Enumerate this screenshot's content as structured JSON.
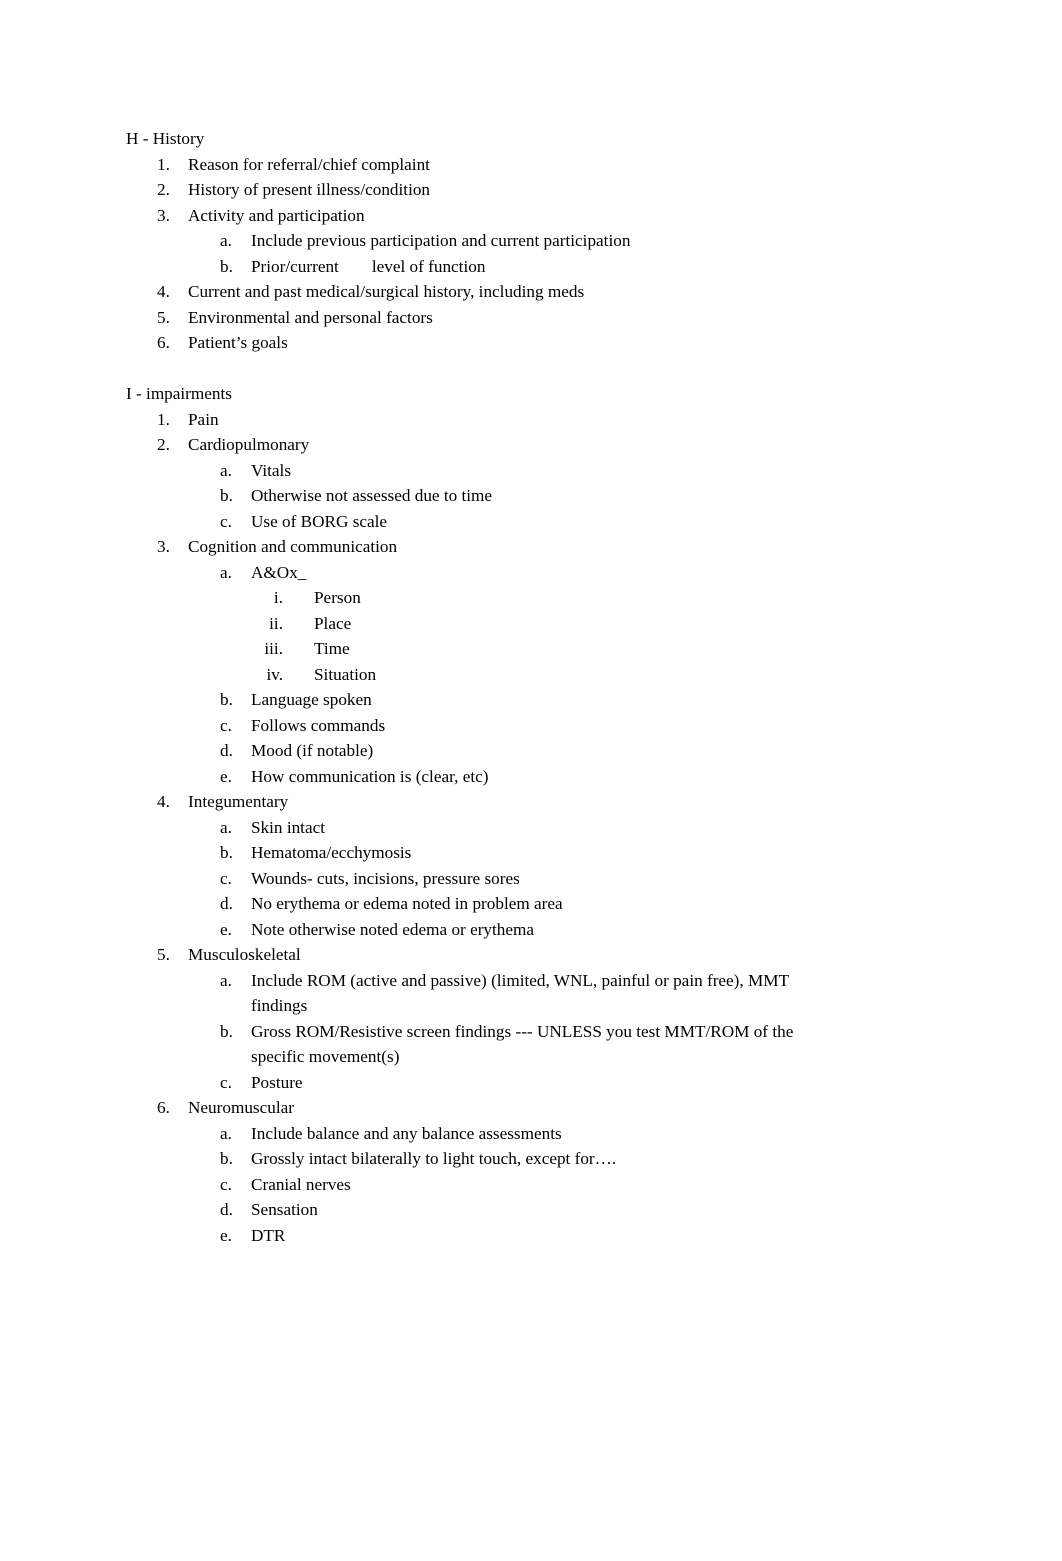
{
  "document": {
    "sections": [
      {
        "heading": "H - History",
        "items": [
          {
            "level": 1,
            "marker": "1.",
            "text": "Reason for referral/chief complaint"
          },
          {
            "level": 1,
            "marker": "2.",
            "text": "History of present illness/condition"
          },
          {
            "level": 1,
            "marker": "3.",
            "text": "Activity and participation"
          },
          {
            "level": 2,
            "marker": "a.",
            "text": "Include previous participation and current participation"
          },
          {
            "level": 2,
            "marker": "b.",
            "text": "Prior/current",
            "text_after_tab": "level of function"
          },
          {
            "level": 1,
            "marker": "4.",
            "text": "Current and past medical/surgical history, including meds"
          },
          {
            "level": 1,
            "marker": "5.",
            "text": "Environmental and personal factors"
          },
          {
            "level": 1,
            "marker": "6.",
            "text": "Patient’s goals"
          }
        ]
      },
      {
        "heading": "I - impairments",
        "items": [
          {
            "level": 1,
            "marker": "1.",
            "text": "Pain"
          },
          {
            "level": 1,
            "marker": "2.",
            "text": "Cardiopulmonary"
          },
          {
            "level": 2,
            "marker": "a.",
            "text": "Vitals"
          },
          {
            "level": 2,
            "marker": "b.",
            "text": "Otherwise not assessed due to time"
          },
          {
            "level": 2,
            "marker": "c.",
            "text": "Use of BORG scale"
          },
          {
            "level": 1,
            "marker": "3.",
            "text": "Cognition and communication"
          },
          {
            "level": 2,
            "marker": "a.",
            "text": "A&Ox_"
          },
          {
            "level": 3,
            "marker": "i.",
            "text": "Person"
          },
          {
            "level": 3,
            "marker": "ii.",
            "text": "Place"
          },
          {
            "level": 3,
            "marker": "iii.",
            "text": "Time"
          },
          {
            "level": 3,
            "marker": "iv.",
            "text": "Situation"
          },
          {
            "level": 2,
            "marker": "b.",
            "text": "Language spoken"
          },
          {
            "level": 2,
            "marker": "c.",
            "text": "Follows commands"
          },
          {
            "level": 2,
            "marker": "d.",
            "text": "Mood (if notable)"
          },
          {
            "level": 2,
            "marker": "e.",
            "text": "How communication is (clear, etc)"
          },
          {
            "level": 1,
            "marker": "4.",
            "text": "Integumentary"
          },
          {
            "level": 2,
            "marker": "a.",
            "text": "Skin intact"
          },
          {
            "level": 2,
            "marker": "b.",
            "text": "Hematoma/ecchymosis"
          },
          {
            "level": 2,
            "marker": "c.",
            "text": "Wounds- cuts, incisions, pressure sores"
          },
          {
            "level": 2,
            "marker": "d.",
            "text": "No erythema or edema noted in problem area"
          },
          {
            "level": 2,
            "marker": "e.",
            "text": "Note otherwise noted edema or erythema"
          },
          {
            "level": 1,
            "marker": "5.",
            "text": "Musculoskeletal"
          },
          {
            "level": 2,
            "marker": "a.",
            "text": "Include ROM (active and passive) (limited, WNL, painful or pain free), MMT findings"
          },
          {
            "level": 2,
            "marker": "b.",
            "text": "Gross ROM/Resistive screen findings --- UNLESS you test MMT/ROM of the specific movement(s)"
          },
          {
            "level": 2,
            "marker": "c.",
            "text": "Posture"
          },
          {
            "level": 1,
            "marker": "6.",
            "text": "Neuromuscular"
          },
          {
            "level": 2,
            "marker": "a.",
            "text": "Include balance and any balance assessments"
          },
          {
            "level": 2,
            "marker": "b.",
            "text": "Grossly intact bilaterally to light touch, except for…."
          },
          {
            "level": 2,
            "marker": "c.",
            "text": "Cranial nerves"
          },
          {
            "level": 2,
            "marker": "d.",
            "text": "Sensation"
          },
          {
            "level": 2,
            "marker": "e.",
            "text": "DTR"
          }
        ]
      }
    ]
  }
}
